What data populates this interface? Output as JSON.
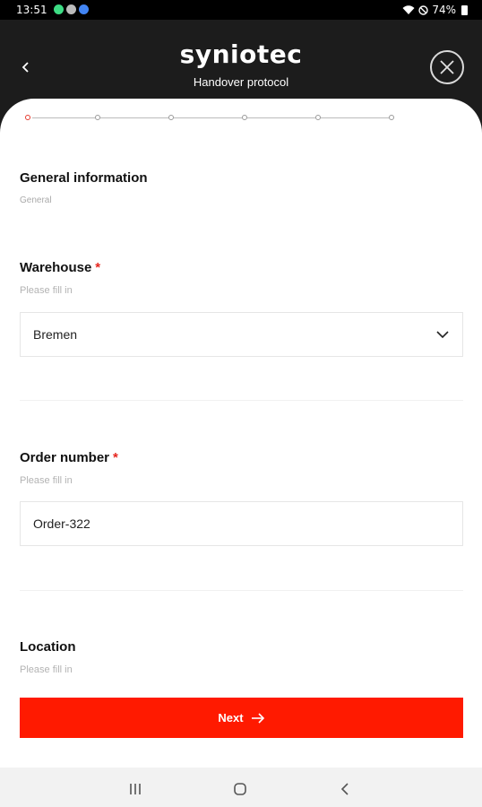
{
  "status_bar": {
    "time": "13:51",
    "battery": "74%",
    "icon_colors": [
      "#3ddc84",
      "#bbbbbb",
      "#4285f4"
    ]
  },
  "header": {
    "brand": "syniotec",
    "subtitle": "Handover protocol"
  },
  "stepper": {
    "steps": 6,
    "current_step": 1
  },
  "section": {
    "title": "General information",
    "subtitle": "General"
  },
  "fields": {
    "warehouse": {
      "label": "Warehouse",
      "required_mark": "*",
      "hint": "Please fill in",
      "value": "Bremen"
    },
    "order_number": {
      "label": "Order number",
      "required_mark": "*",
      "hint": "Please fill in",
      "value": "Order-322"
    },
    "location": {
      "label": "Location",
      "hint": "Please fill in"
    }
  },
  "actions": {
    "next_label": "Next"
  },
  "colors": {
    "accent": "#ff1a00",
    "required": "#e6261f",
    "header_bg": "#1c1c1c"
  }
}
